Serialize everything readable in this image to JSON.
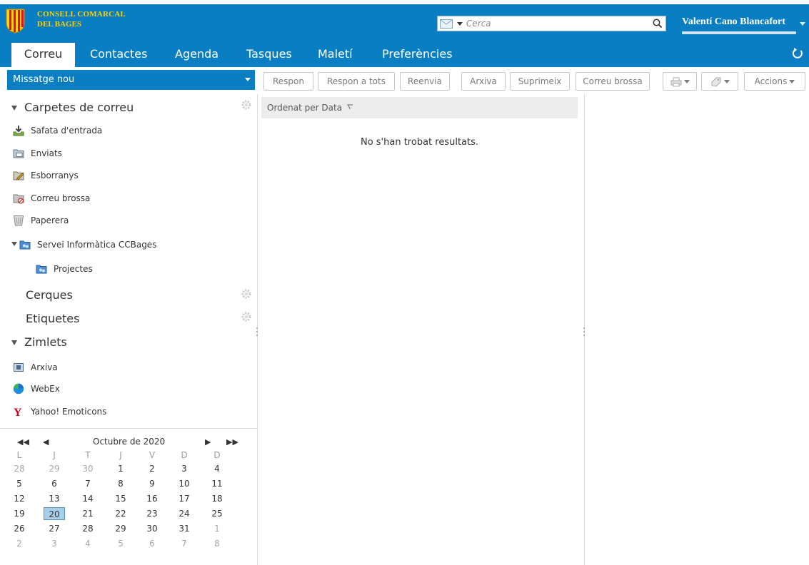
{
  "header": {
    "org_line1": "CONSELL COMARCAL",
    "org_line2": "DEL BAGES",
    "search_placeholder": "Cerca",
    "user_name": "Valentí Cano Blancafort",
    "brand_color": "#0a7ec2",
    "org_color": "#ffd200"
  },
  "tabs": [
    {
      "label": "Correu",
      "active": true
    },
    {
      "label": "Contactes"
    },
    {
      "label": "Agenda"
    },
    {
      "label": "Tasques"
    },
    {
      "label": "Maletí"
    },
    {
      "label": "Preferències"
    }
  ],
  "toolbar": {
    "new_message": "Missatge nou",
    "buttons": [
      "Respon",
      "Respon a tots",
      "Reenvia",
      "Arxiva",
      "Suprimeix",
      "Correu brossa"
    ],
    "actions": "Accions"
  },
  "sidebar": {
    "mail_folders_title": "Carpetes de correu",
    "folders": [
      {
        "label": "Safata d'entrada",
        "icon": "inbox-icon"
      },
      {
        "label": "Enviats",
        "icon": "sent-icon"
      },
      {
        "label": "Esborranys",
        "icon": "drafts-icon"
      },
      {
        "label": "Correu brossa",
        "icon": "junk-icon"
      },
      {
        "label": "Paperera",
        "icon": "trash-icon"
      }
    ],
    "shared_folder": "Servei  Informàtica CCBages",
    "shared_subfolder": "Projectes",
    "searches_title": "Cerques",
    "tags_title": "Etiquetes",
    "zimlets_title": "Zimlets",
    "zimlets": [
      {
        "label": "Arxiva",
        "icon": "archive-zimlet-icon"
      },
      {
        "label": "WebEx",
        "icon": "webex-icon"
      },
      {
        "label": "Yahoo! Emoticons",
        "icon": "yahoo-icon"
      }
    ]
  },
  "calendar": {
    "title": "Octubre de 2020",
    "weekdays": [
      "L",
      "J",
      "T",
      "J",
      "V",
      "D",
      "D"
    ],
    "weeks": [
      [
        "28",
        "29",
        "30",
        "1",
        "2",
        "3",
        "4"
      ],
      [
        "5",
        "6",
        "7",
        "8",
        "9",
        "10",
        "11"
      ],
      [
        "12",
        "13",
        "14",
        "15",
        "16",
        "17",
        "18"
      ],
      [
        "19",
        "20",
        "21",
        "22",
        "23",
        "24",
        "25"
      ],
      [
        "26",
        "27",
        "28",
        "29",
        "30",
        "31",
        "1"
      ],
      [
        "2",
        "3",
        "4",
        "5",
        "6",
        "7",
        "8"
      ]
    ],
    "selected": "20"
  },
  "messages": {
    "sort_label": "Ordenat per Data",
    "empty_text": "No s'han trobat resultats."
  }
}
